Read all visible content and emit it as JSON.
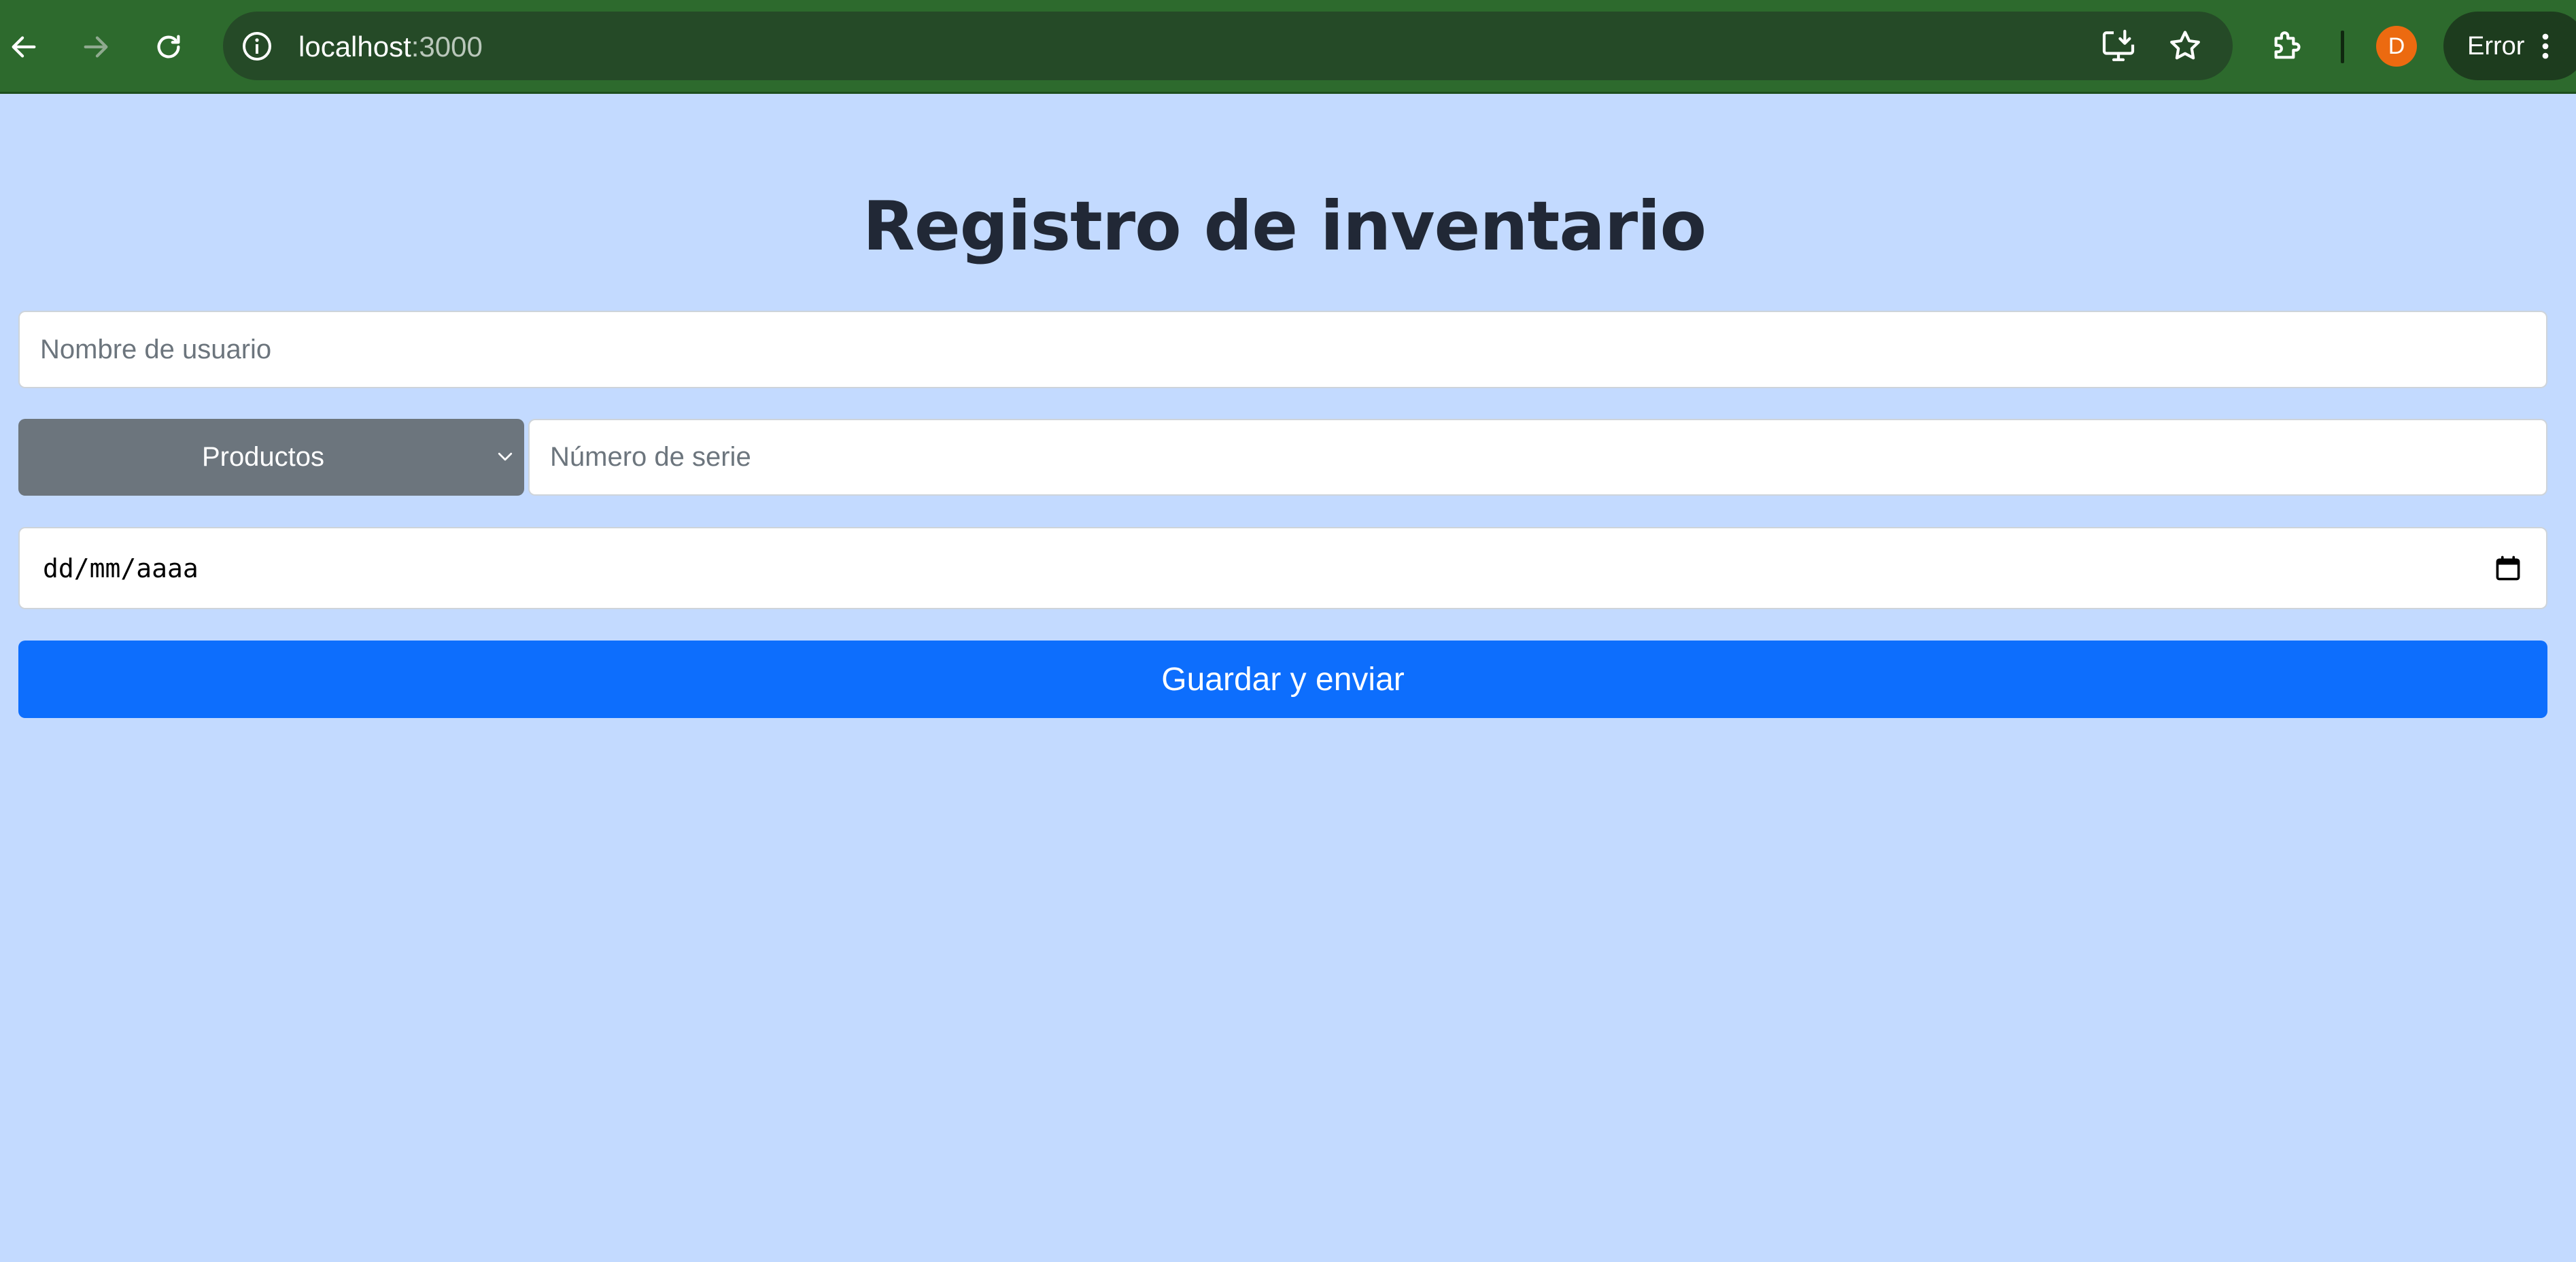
{
  "browser": {
    "url_host": "localhost",
    "url_port": ":3000",
    "profile_initial": "D",
    "status_label": "Error",
    "icons": {
      "back": "back-arrow-icon",
      "forward": "forward-arrow-icon",
      "reload": "reload-icon",
      "site_info": "site-info-icon",
      "install_app": "install-app-icon",
      "bookmark": "bookmark-star-icon",
      "extensions": "extensions-puzzle-icon",
      "menu": "kebab-menu-icon"
    },
    "colors": {
      "toolbar": "#2d6a2d",
      "omnibox": "#254a27",
      "avatar": "#ec6a10"
    }
  },
  "form": {
    "title": "Registro de inventario",
    "username_placeholder": "Nombre de usuario",
    "product_select_label": "Productos",
    "serial_placeholder": "Número de serie",
    "date_placeholder": "dd/mm/aaaa",
    "submit_label": "Guardar y enviar",
    "colors": {
      "background": "#c3daff",
      "select": "#6c757d",
      "submit": "#0d6efd"
    }
  }
}
